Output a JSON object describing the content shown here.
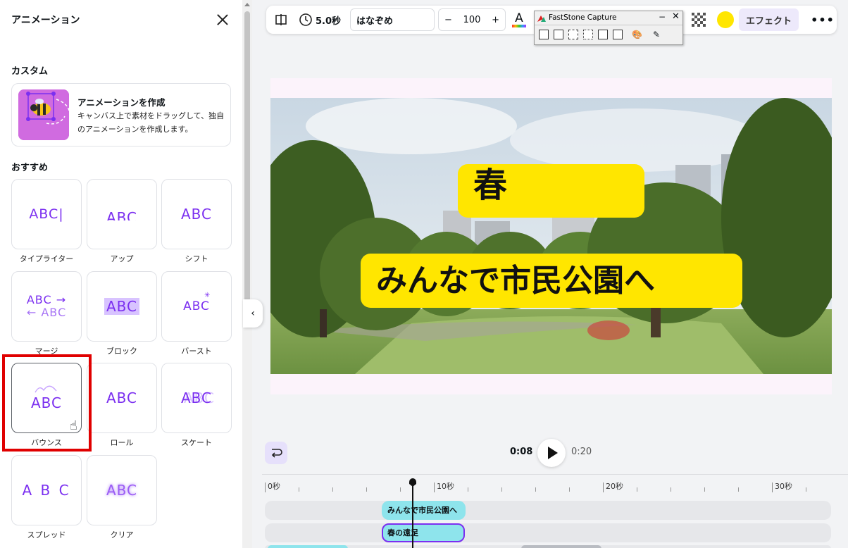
{
  "panel": {
    "title": "アニメーション",
    "custom_heading": "カスタム",
    "create_card": {
      "title": "アニメーションを作成",
      "description": "キャンバス上で素材をドラッグして、独自のアニメーションを作成します。"
    },
    "recommend_heading": "おすすめ",
    "tiles": [
      {
        "label": "タイプライター",
        "demo": "ABC",
        "icon": "typewriter-preview"
      },
      {
        "label": "アップ",
        "demo": "ABC",
        "icon": "rise-preview"
      },
      {
        "label": "シフト",
        "demo": "ABC",
        "icon": "shift-preview"
      },
      {
        "label": "マージ",
        "demo_top": "ABC →",
        "demo_bottom": "← ABC",
        "icon": "merge-preview"
      },
      {
        "label": "ブロック",
        "demo": "ABC",
        "icon": "block-preview"
      },
      {
        "label": "バースト",
        "demo": "ABC",
        "icon": "burst-preview"
      },
      {
        "label": "バウンス",
        "demo": "ABC",
        "icon": "bounce-preview",
        "selected": true
      },
      {
        "label": "ロール",
        "demo": "ABC",
        "icon": "roll-preview"
      },
      {
        "label": "スケート",
        "demo": "ABC",
        "icon": "skate-preview"
      },
      {
        "label": "スプレッド",
        "demo": "A B C",
        "icon": "spread-preview"
      },
      {
        "label": "クリア",
        "demo": "ABC",
        "icon": "clear-preview"
      }
    ]
  },
  "toolbar": {
    "duration": "5.0秒",
    "font": "はなぞめ",
    "font_size": "100",
    "minus": "−",
    "plus": "+",
    "color_letter": "A",
    "effect_label": "エフェクト",
    "more_label": "•••",
    "fill_color": "#ffe600"
  },
  "faststone": {
    "title": "FastStone Capture",
    "minimize": "−",
    "close": "✕"
  },
  "canvas": {
    "title_text": "春",
    "subtitle_text": "みんなで市民公園へ",
    "textbox_color": "#ffe600"
  },
  "playback": {
    "current_time": "0:08",
    "total_time": "0:20"
  },
  "timeline": {
    "ruler_labels": [
      "0秒",
      "10秒",
      "20秒",
      "30秒"
    ],
    "tracks": [
      {
        "label": "みんなで市民公園へ"
      },
      {
        "label": "春の遠足"
      }
    ]
  },
  "colors": {
    "accent": "#7b2ff0",
    "clip": "#8ee4ec",
    "highlight": "#e00000"
  }
}
